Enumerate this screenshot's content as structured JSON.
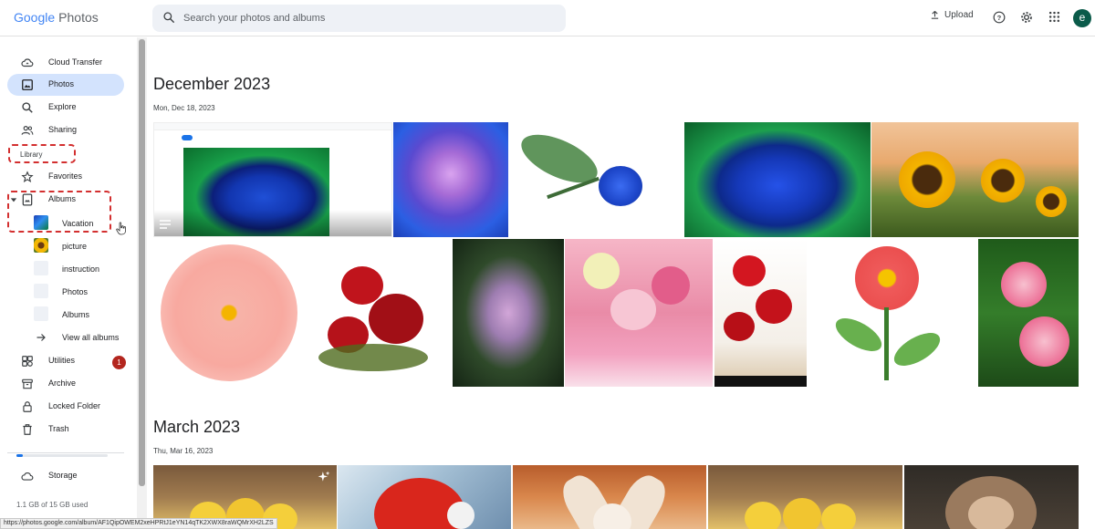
{
  "header": {
    "logo_google": "Google",
    "logo_photos": "Photos",
    "search_placeholder": "Search your photos and albums",
    "upload_label": "Upload",
    "avatar_letter": "e"
  },
  "sidebar": {
    "items": [
      {
        "label": "Cloud Transfer",
        "icon": "cloud-sync-icon"
      },
      {
        "label": "Photos",
        "icon": "photo-icon",
        "active": true
      },
      {
        "label": "Explore",
        "icon": "search-icon"
      },
      {
        "label": "Sharing",
        "icon": "people-icon"
      }
    ],
    "library_label": "Library",
    "library_items": [
      {
        "label": "Favorites",
        "icon": "star-icon"
      },
      {
        "label": "Albums",
        "icon": "album-icon"
      }
    ],
    "albums": [
      {
        "label": "Vacation"
      },
      {
        "label": "picture"
      },
      {
        "label": "instruction"
      },
      {
        "label": "Photos"
      },
      {
        "label": "Albums"
      },
      {
        "label": "View all albums"
      }
    ],
    "bottom_items": [
      {
        "label": "Utilities",
        "icon": "utilities-icon",
        "badge": "1"
      },
      {
        "label": "Archive",
        "icon": "archive-icon"
      },
      {
        "label": "Locked Folder",
        "icon": "lock-icon"
      },
      {
        "label": "Trash",
        "icon": "trash-icon"
      }
    ],
    "storage_label": "Storage",
    "storage_used_text": "1.1 GB of 15 GB used",
    "storage_fraction": 0.073
  },
  "main": {
    "sections": [
      {
        "month": "December 2023",
        "date": "Mon, Dec 18, 2023"
      },
      {
        "month": "March 2023",
        "date": "Thu, Mar 16, 2023"
      }
    ]
  },
  "status_url": "https://photos.google.com/album/AF1QipOWEM2xeHPRtJ1eYN14qTK2XWX8raWQMrXH2LZS",
  "colors": {
    "accent": "#1a73e8",
    "active_bg": "#d3e3fd",
    "badge": "#b3261e",
    "highlight_box": "#d32f2f"
  }
}
